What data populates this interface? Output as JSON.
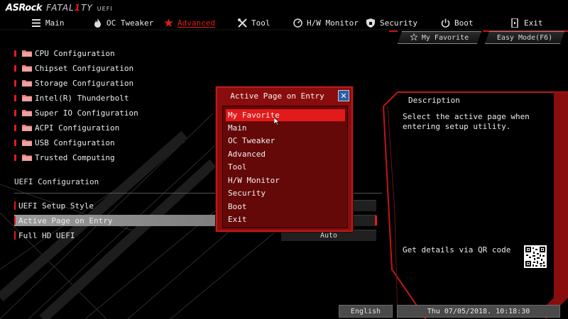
{
  "brand": {
    "asrock": "ASRock",
    "fatality_pre": "FATAL",
    "fatality_one": "1",
    "fatality_post": "TY",
    "uefi": "UEFI"
  },
  "nav": [
    {
      "label": "Main",
      "icon": "list-icon"
    },
    {
      "label": "OC Tweaker",
      "icon": "flame-icon"
    },
    {
      "label": "Advanced",
      "icon": "star-icon"
    },
    {
      "label": "Tool",
      "icon": "wrench-icon"
    },
    {
      "label": "H/W Monitor",
      "icon": "monitor-icon"
    },
    {
      "label": "Security",
      "icon": "shield-icon"
    },
    {
      "label": "Boot",
      "icon": "power-icon"
    },
    {
      "label": "Exit",
      "icon": "exit-icon"
    }
  ],
  "active_tab": "Advanced",
  "toolbar": {
    "favorite_label": "My Favorite",
    "easy_mode_label": "Easy Mode(F6)"
  },
  "menu": [
    "CPU Configuration",
    "Chipset Configuration",
    "Storage Configuration",
    "Intel(R) Thunderbolt",
    "Super IO Configuration",
    "ACPI Configuration",
    "USB Configuration",
    "Trusted Computing"
  ],
  "uefi_section": {
    "title": "UEFI Configuration",
    "options": [
      {
        "label": "UEFI Setup Style",
        "value": ""
      },
      {
        "label": "Active Page on Entry",
        "value": ""
      },
      {
        "label": "Full HD UEFI",
        "value": "Auto"
      }
    ]
  },
  "description": {
    "title": "Description",
    "text": "Select the active page when entering setup utility.",
    "qr_text": "Get details via QR code"
  },
  "popup": {
    "title": "Active Page on Entry",
    "close_label": "✕",
    "options": [
      "My Favorite",
      "Main",
      "OC Tweaker",
      "Advanced",
      "Tool",
      "H/W Monitor",
      "Security",
      "Boot",
      "Exit"
    ],
    "selected": "My Favorite"
  },
  "footer": {
    "language": "English",
    "datetime": "Thu 07/05/2018. 10:18:30"
  },
  "colors": {
    "accent": "#e41b17",
    "popup_bg": "#8a0d0d",
    "popup_inner": "#650808",
    "selected": "#e21a1a"
  }
}
